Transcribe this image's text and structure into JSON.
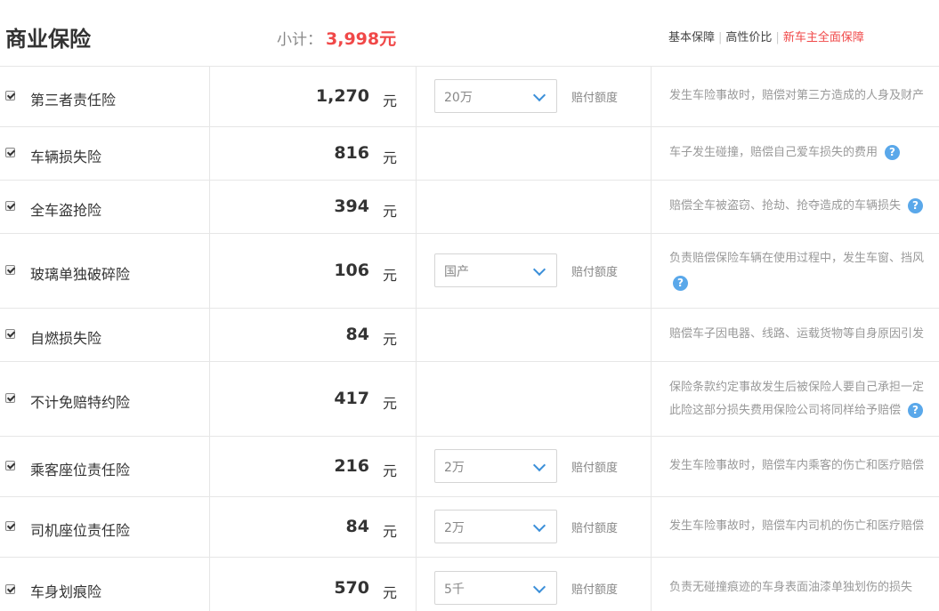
{
  "header": {
    "title": "商业保险",
    "subtotal_label": "小计：",
    "subtotal_amount": "3,998元",
    "plans": [
      "基本保障",
      "高性价比",
      "新车主全面保障"
    ]
  },
  "colors": {
    "accent": "#f04848",
    "help": "#5aa8ea",
    "chevron": "#3b8fd9"
  },
  "items": [
    {
      "name": "第三者责任险",
      "price": "1,270",
      "unit": "元",
      "select": "20万",
      "select_label": "赔付额度",
      "desc1": "发生车险事故时，赔偿对第三方造成的人身及财产",
      "desc2": "",
      "help": false
    },
    {
      "name": "车辆损失险",
      "price": "816",
      "unit": "元",
      "select": "",
      "select_label": "",
      "desc1": "车子发生碰撞，赔偿自己爱车损失的费用",
      "desc2": "",
      "help": true
    },
    {
      "name": "全车盗抢险",
      "price": "394",
      "unit": "元",
      "select": "",
      "select_label": "",
      "desc1": "赔偿全车被盗窃、抢劫、抢夺造成的车辆损失",
      "desc2": "",
      "help": true
    },
    {
      "name": "玻璃单独破碎险",
      "price": "106",
      "unit": "元",
      "select": "国产",
      "select_label": "赔付额度",
      "desc1": "负责赔偿保险车辆在使用过程中，发生车窗、挡风",
      "desc2": "",
      "help": true
    },
    {
      "name": "自燃损失险",
      "price": "84",
      "unit": "元",
      "select": "",
      "select_label": "",
      "desc1": "赔偿车子因电器、线路、运载货物等自身原因引发",
      "desc2": "",
      "help": false
    },
    {
      "name": "不计免赔特约险",
      "price": "417",
      "unit": "元",
      "select": "",
      "select_label": "",
      "desc1": "保险条款约定事故发生后被保险人要自己承担一定",
      "desc2": "此险这部分损失费用保险公司将同样给予赔偿",
      "help": true
    },
    {
      "name": "乘客座位责任险",
      "price": "216",
      "unit": "元",
      "select": "2万",
      "select_label": "赔付额度",
      "desc1": "发生车险事故时，赔偿车内乘客的伤亡和医疗赔偿",
      "desc2": "",
      "help": false
    },
    {
      "name": "司机座位责任险",
      "price": "84",
      "unit": "元",
      "select": "2万",
      "select_label": "赔付额度",
      "desc1": "发生车险事故时，赔偿车内司机的伤亡和医疗赔偿",
      "desc2": "",
      "help": false
    },
    {
      "name": "车身划痕险",
      "price": "570",
      "unit": "元",
      "select": "5千",
      "select_label": "赔付额度",
      "desc1": "负责无碰撞痕迹的车身表面油漆单独划伤的损失",
      "desc2": "",
      "help": false
    }
  ]
}
